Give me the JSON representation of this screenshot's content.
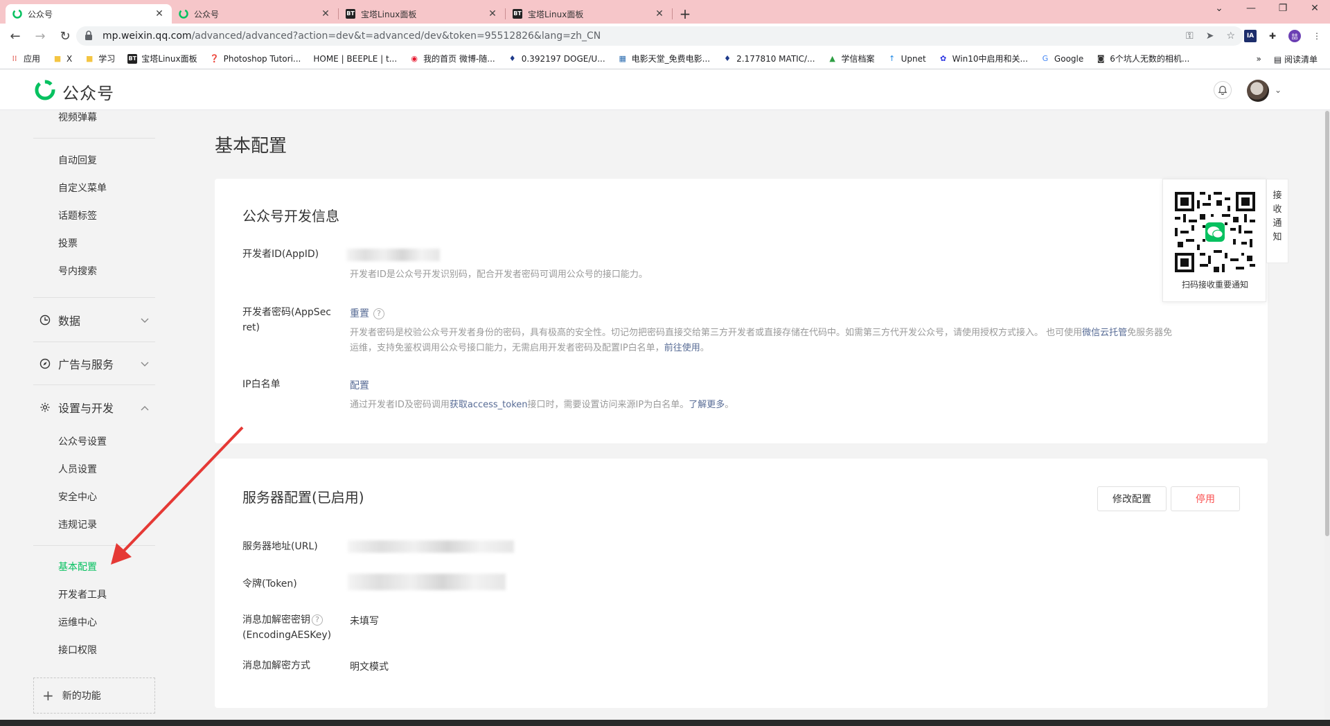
{
  "browser": {
    "tabs": [
      {
        "title": "公众号",
        "favicon": "wechat-mp-icon"
      },
      {
        "title": "公众号",
        "favicon": "wechat-mp-icon"
      },
      {
        "title": "宝塔Linux面板",
        "favicon": "bt-icon"
      },
      {
        "title": "宝塔Linux面板",
        "favicon": "bt-icon"
      }
    ],
    "bt_badge": "BT",
    "url_host": "mp.weixin.qq.com",
    "url_path": "/advanced/advanced?action=dev&t=advanced/dev&token=95512826&lang=zh_CN",
    "ext_ia_label": "IA",
    "profile_label": "喆",
    "bookmarks": [
      {
        "label": "应用"
      },
      {
        "label": "X"
      },
      {
        "label": "学习"
      },
      {
        "label": "宝塔Linux面板"
      },
      {
        "label": "Photoshop Tutori..."
      },
      {
        "label": "HOME | BEEPLE | t..."
      },
      {
        "label": "我的首页 微博-随..."
      },
      {
        "label": "0.392197 DOGE/U..."
      },
      {
        "label": "电影天堂_免费电影..."
      },
      {
        "label": "2.177810 MATIC/..."
      },
      {
        "label": "学信档案"
      },
      {
        "label": "Upnet"
      },
      {
        "label": "Win10中启用和关..."
      },
      {
        "label": "Google"
      },
      {
        "label": "6个坑人无数的相机..."
      }
    ],
    "bookmarks_more": "»",
    "reading_list": "阅读清单"
  },
  "header": {
    "logo_text": "公众号"
  },
  "sidebar": {
    "items_top": [
      "视频弹幕",
      "自动回复",
      "自定义菜单",
      "话题标签",
      "投票",
      "号内搜索"
    ],
    "groups": [
      {
        "label": "数据",
        "icon": "chart-clock-icon",
        "expanded": false
      },
      {
        "label": "广告与服务",
        "icon": "compass-icon",
        "expanded": false
      },
      {
        "label": "设置与开发",
        "icon": "gear-icon",
        "expanded": true
      }
    ],
    "settings_items": [
      "公众号设置",
      "人员设置",
      "安全中心",
      "违规记录"
    ],
    "dev_items": [
      "基本配置",
      "开发者工具",
      "运维中心",
      "接口权限"
    ],
    "active_item": "基本配置",
    "new_feature": "新的功能"
  },
  "main": {
    "page_title": "基本配置",
    "dev_info": {
      "title": "公众号开发信息",
      "appid_label": "开发者ID(AppID)",
      "appid_desc": "开发者ID是公众号开发识别码，配合开发者密码可调用公众号的接口能力。",
      "secret_label_1": "开发者密码(AppSec",
      "secret_label_2": "ret)",
      "secret_action": "重置",
      "secret_desc_1a": "开发者密码是校验公众号开发者身份的密码，具有极高的安全性。切记勿把密码直接交给第三方开发者或直接存储在代码中。如需第三方代开发公众号，请使用授权方式接入。 也可使用",
      "secret_desc_1b": "微信云托管",
      "secret_desc_1c": "免服务器免",
      "secret_desc_2a": "运维，支持免鉴权调用公众号接口能力，无需启用开发者密码及配置IP白名单，",
      "secret_desc_2b": "前往使用",
      "secret_desc_2c": "。",
      "ip_label": "IP白名单",
      "ip_action": "配置",
      "ip_desc_a": "通过开发者ID及密码调用",
      "ip_desc_b": "获取access_token",
      "ip_desc_c": "接口时，需要设置访问来源IP为白名单。",
      "ip_desc_d": "了解更多",
      "ip_desc_e": "。"
    },
    "server_config": {
      "title": "服务器配置(已启用)",
      "edit_button": "修改配置",
      "stop_button": "停用",
      "url_label": "服务器地址(URL)",
      "token_label": "令牌(Token)",
      "aes_label_1": "消息加解密密钥",
      "aes_label_2": "(EncodingAESKey)",
      "aes_value": "未填写",
      "mode_label": "消息加解密方式",
      "mode_value": "明文模式"
    },
    "qr": {
      "caption": "扫码接收重要通知",
      "side_tab": [
        "接",
        "收",
        "通",
        "知"
      ]
    }
  },
  "colors": {
    "accent_green": "#07c160",
    "link_blue": "#576b95",
    "danger_red": "#fa5151",
    "tabbar_pink": "#f6c6c9",
    "annotation_arrow": "#e53935"
  }
}
